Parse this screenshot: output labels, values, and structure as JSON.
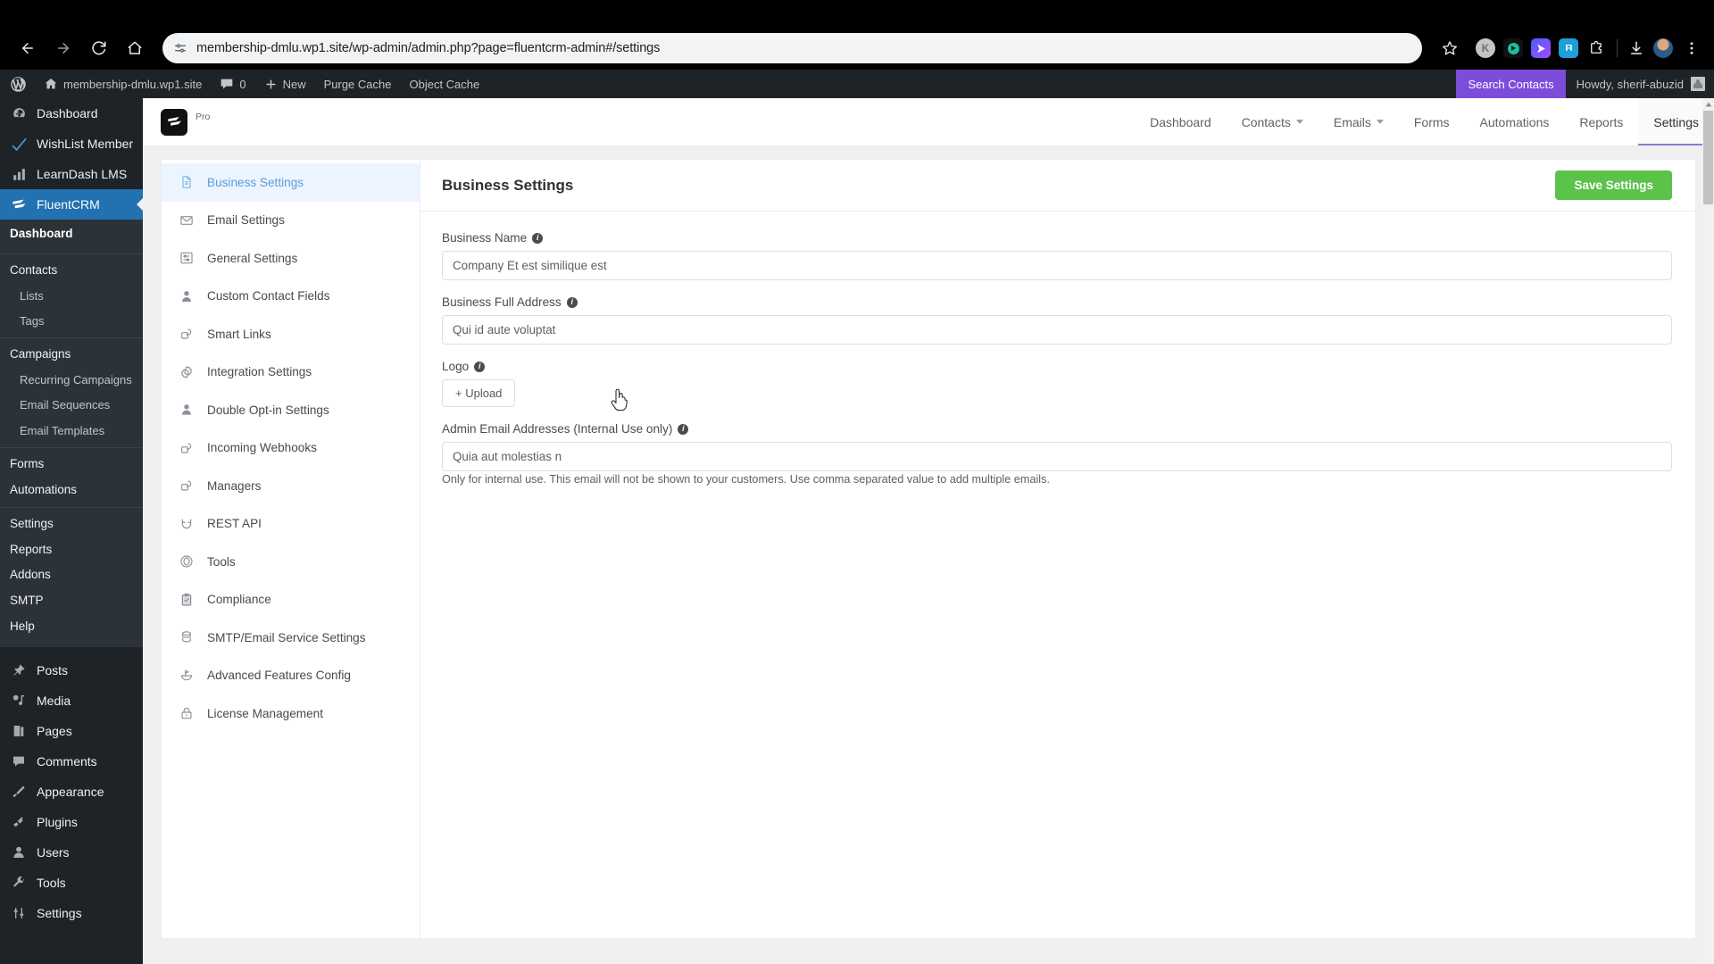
{
  "browser": {
    "url": "membership-dmlu.wp1.site/wp-admin/admin.php?page=fluentcrm-admin#/settings",
    "extensions": [
      "K",
      "",
      "",
      "FI",
      ""
    ]
  },
  "wp_adminbar": {
    "site_name": "membership-dmlu.wp1.site",
    "comment_count": "0",
    "new_label": "New",
    "purge_cache": "Purge Cache",
    "object_cache": "Object Cache",
    "search_contacts": "Search Contacts",
    "howdy": "Howdy, sherif-abuzid"
  },
  "wp_menu": {
    "top": [
      {
        "label": "Dashboard",
        "icon": "dashboard-icon",
        "active": false
      },
      {
        "label": "WishList Member",
        "icon": "wishlist-icon",
        "active": false
      },
      {
        "label": "LearnDash LMS",
        "icon": "bar-chart-icon",
        "active": false
      },
      {
        "label": "FluentCRM",
        "icon": "fluentcrm-icon",
        "active": true
      }
    ],
    "fluentcrm_sub": [
      {
        "label": "Dashboard",
        "type": "current"
      },
      {
        "label": "Contacts",
        "type": "head"
      },
      {
        "label": "Lists",
        "type": "indent"
      },
      {
        "label": "Tags",
        "type": "indent"
      },
      {
        "label": "Campaigns",
        "type": "head"
      },
      {
        "label": "Recurring Campaigns",
        "type": "indent"
      },
      {
        "label": "Email Sequences",
        "type": "indent"
      },
      {
        "label": "Email Templates",
        "type": "indent"
      },
      {
        "label": "Forms",
        "type": "head"
      },
      {
        "label": "Automations",
        "type": "head"
      },
      {
        "label": "Settings",
        "type": "head2"
      },
      {
        "label": "Reports",
        "type": "head2"
      },
      {
        "label": "Addons",
        "type": "head2"
      },
      {
        "label": "SMTP",
        "type": "head2"
      },
      {
        "label": "Help",
        "type": "head2"
      }
    ],
    "bottom": [
      {
        "label": "Posts",
        "icon": "pin-icon"
      },
      {
        "label": "Media",
        "icon": "media-icon"
      },
      {
        "label": "Pages",
        "icon": "pages-icon"
      },
      {
        "label": "Comments",
        "icon": "comment-icon"
      },
      {
        "label": "Appearance",
        "icon": "brush-icon"
      },
      {
        "label": "Plugins",
        "icon": "plug-icon"
      },
      {
        "label": "Users",
        "icon": "user-icon"
      },
      {
        "label": "Tools",
        "icon": "wrench-icon"
      },
      {
        "label": "Settings",
        "icon": "sliders-icon"
      }
    ]
  },
  "crm_header": {
    "pro_label": "Pro",
    "nav": [
      {
        "label": "Dashboard",
        "dropdown": false,
        "active": false
      },
      {
        "label": "Contacts",
        "dropdown": true,
        "active": false
      },
      {
        "label": "Emails",
        "dropdown": true,
        "active": false
      },
      {
        "label": "Forms",
        "dropdown": false,
        "active": false
      },
      {
        "label": "Automations",
        "dropdown": false,
        "active": false
      },
      {
        "label": "Reports",
        "dropdown": false,
        "active": false
      },
      {
        "label": "Settings",
        "dropdown": false,
        "active": true
      }
    ]
  },
  "settings_nav": [
    {
      "label": "Business Settings",
      "icon": "document-icon",
      "active": true
    },
    {
      "label": "Email Settings",
      "icon": "envelope-icon",
      "active": false
    },
    {
      "label": "General Settings",
      "icon": "sliders-box-icon",
      "active": false
    },
    {
      "label": "Custom Contact Fields",
      "icon": "person-icon",
      "active": false
    },
    {
      "label": "Smart Links",
      "icon": "link-loop-icon",
      "active": false
    },
    {
      "label": "Integration Settings",
      "icon": "gear-icon",
      "active": false
    },
    {
      "label": "Double Opt-in Settings",
      "icon": "person-icon",
      "active": false
    },
    {
      "label": "Incoming Webhooks",
      "icon": "link-loop-icon",
      "active": false
    },
    {
      "label": "Managers",
      "icon": "link-loop-icon",
      "active": false
    },
    {
      "label": "REST API",
      "icon": "magnet-icon",
      "active": false
    },
    {
      "label": "Tools",
      "icon": "circle-target-icon",
      "active": false
    },
    {
      "label": "Compliance",
      "icon": "clipboard-check-icon",
      "active": false
    },
    {
      "label": "SMTP/Email Service Settings",
      "icon": "stack-icon",
      "active": false
    },
    {
      "label": "Advanced Features Config",
      "icon": "flag-bowl-icon",
      "active": false
    },
    {
      "label": "License Management",
      "icon": "lock-icon",
      "active": false
    }
  ],
  "main": {
    "title": "Business Settings",
    "save_label": "Save Settings",
    "fields": {
      "business_name": {
        "label": "Business Name",
        "value": "Company Et est similique est"
      },
      "business_address": {
        "label": "Business Full Address",
        "value": "Qui id aute voluptat"
      },
      "logo": {
        "label": "Logo",
        "upload_label": "+ Upload"
      },
      "admin_email": {
        "label": "Admin Email Addresses (Internal Use only)",
        "value": "Quia aut molestias n",
        "helper": "Only for internal use. This email will not be shown to your customers. Use comma separated value to add multiple emails."
      }
    }
  },
  "colors": {
    "wp_dark": "#1d2327",
    "wp_blue": "#2271b1",
    "purple": "#7c4ddb",
    "save_green": "#5bc24a",
    "active_blue": "#5b9bd5"
  }
}
